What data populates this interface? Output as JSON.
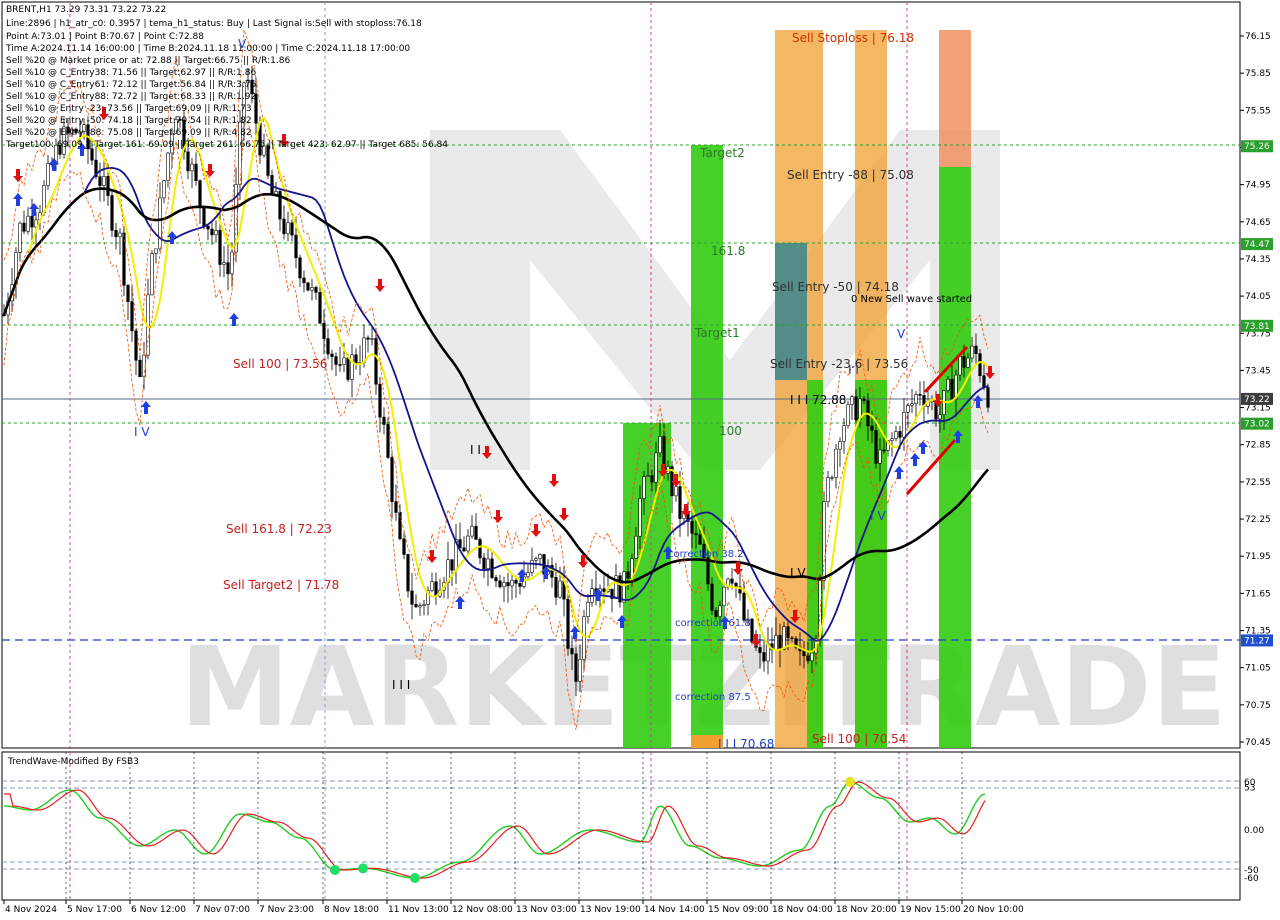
{
  "header": {
    "lines": [
      "BRENT,H1  73.29 73.31 73.22 73.22",
      "Line:2896 | h1_atr_c0: 0.3957 | tema_h1_status: Buy | Last Signal is:Sell with stoploss:76.18",
      "Point A:73.01 | Point B:70.67 | Point C:72.88",
      "Time A:2024.11.14 16:00:00 | Time B:2024.11.18 11:00:00 | Time C:2024.11.18 17:00:00",
      "Sell %20 @ Market price or at: 72.88 || Target:66.75 || R/R:1.86",
      "Sell %10 @ C_Entry38: 71.56 || Target:62.97 || R/R:1.86",
      "Sell %10 @ C_Entry61: 72.12 || Target:56.84 || R/R:3.76",
      "Sell %10 @ C_Entry88: 72.72 || Target:68.33 || R/R:1.92",
      "Sell %10 @ Entry -23: 73.56 || Target:69.09 || R/R:1.73",
      "Sell %20 @ Entry -50: 74.18 || Target:70.54 || R/R:1.82",
      "Sell %20 @ Entry -88: 75.08 || Target:69.09 || R/R:4.82",
      "Target100: 69.09 || Target 161: 69.09 || Target 261: 66.75 || Target 423: 62.97 || Target 685: 56.84"
    ]
  },
  "price_axis": {
    "ticks": [
      "76.15",
      "75.85",
      "75.55",
      "75.25",
      "74.95",
      "74.65",
      "74.35",
      "74.05",
      "73.75",
      "73.45",
      "73.15",
      "72.85",
      "72.55",
      "72.25",
      "71.95",
      "71.65",
      "71.35",
      "71.05",
      "70.75",
      "70.45"
    ],
    "tags": [
      {
        "value": "75.26",
        "color": "#2ca02c"
      },
      {
        "value": "74.47",
        "color": "#2ca02c"
      },
      {
        "value": "73.81",
        "color": "#2ca02c"
      },
      {
        "value": "73.22",
        "color": "#3c3c3c"
      },
      {
        "value": "73.02",
        "color": "#2ca02c"
      },
      {
        "value": "71.27",
        "color": "#1f4fd0"
      }
    ]
  },
  "time_axis": {
    "labels": [
      "4 Nov 2024",
      "5 Nov 17:00",
      "6 Nov 12:00",
      "7 Nov 07:00",
      "7 Nov 23:00",
      "8 Nov 18:00",
      "11 Nov 13:00",
      "12 Nov 08:00",
      "13 Nov 03:00",
      "13 Nov 19:00",
      "14 Nov 14:00",
      "15 Nov 09:00",
      "18 Nov 04:00",
      "18 Nov 20:00",
      "19 Nov 15:00",
      "20 Nov 10:00"
    ]
  },
  "annotations": {
    "sell_stoploss": "Sell Stoploss | 76.18",
    "target2": "Target2",
    "sell_entry_88": "Sell Entry -88 | 75.08",
    "fib_1618": "161.8",
    "sell_entry_50": "Sell Entry -50 | 74.18",
    "new_wave": "0 New Sell wave started",
    "target1": "Target1",
    "sell_entry_236": "Sell Entry -23.6 | 73.56",
    "sell100_top": "Sell 100 | 73.56",
    "wave_iii_top": "I I I 72.88",
    "fib_100": "100",
    "sell1618": "Sell 161.8 | 72.23",
    "sell_target2": "Sell Target2 | 71.78",
    "correction382": "correction 38.2",
    "correction618": "correction 61.8",
    "correction875": "correction 87.5",
    "sell100_bottom": "Sell 100 | 70.54",
    "wave_iii_bottom": "I I I 70.68",
    "wave_iv_left": "I V",
    "wave_iv_mid": "I V",
    "wave_iv_right": "I V",
    "wave_v_top": "V",
    "wave_v_right": "V",
    "wave_v_mid": "I V",
    "wave_ii": "I I",
    "wave_iii_small": "I I I",
    "wave_i": "I I"
  },
  "watermark": "MARKETZITRADE",
  "oscillator": {
    "title": "TrendWave-Modified By FSB3",
    "ticks": [
      "60",
      "53",
      "0.00",
      "-50",
      "-60"
    ]
  },
  "colors": {
    "up_arrow": "#1f3fe0",
    "down_arrow": "#e01010",
    "green_zone": "#33cc11",
    "orange_zone": "#f0a030",
    "teal_zone": "#4a8a8a",
    "ma_yellow": "#f0f000",
    "ma_navy": "#14148c",
    "ma_black": "#000000"
  },
  "chart_data": {
    "type": "line",
    "title": "BRENT,H1",
    "series": [
      {
        "name": "",
        "points": [
          [
            "4 Nov 2024",
            73.9
          ],
          [
            "5 Nov 17:00",
            74.8
          ],
          [
            "6 Nov 12:00",
            74.5
          ],
          [
            "7 Nov 07:00",
            74.4
          ],
          [
            "7 Nov 23:00",
            74.6
          ],
          [
            "8 Nov 18:00",
            73.5
          ],
          [
            "11 Nov 13:00",
            71.6
          ],
          [
            "12 Nov 08:00",
            71.9
          ],
          [
            "13 Nov 03:00",
            71.9
          ],
          [
            "13 Nov 19:00",
            71.7
          ],
          [
            "14 Nov 14:00",
            72.6
          ],
          [
            "15 Nov 09:00",
            71.4
          ],
          [
            "18 Nov 04:00",
            71.1
          ],
          [
            "18 Nov 20:00",
            72.9
          ],
          [
            "19 Nov 15:00",
            73.1
          ],
          [
            "20 Nov 10:00",
            73.22
          ]
        ]
      }
    ],
    "ylim": [
      70.4,
      76.25
    ]
  }
}
